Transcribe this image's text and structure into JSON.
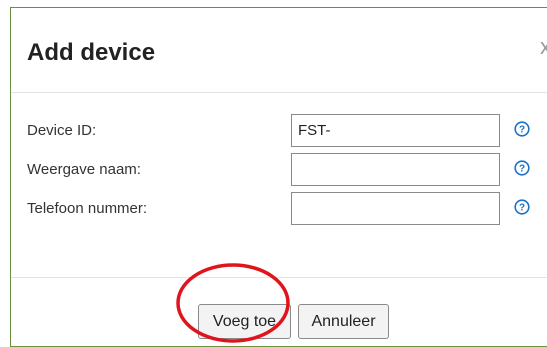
{
  "dialog": {
    "title": "Add device",
    "close_label": "x"
  },
  "form": {
    "fields": [
      {
        "label": "Device ID:",
        "value": "FST-",
        "placeholder": ""
      },
      {
        "label": "Weergave naam:",
        "value": "",
        "placeholder": ""
      },
      {
        "label": "Telefoon nummer:",
        "value": "",
        "placeholder": ""
      }
    ]
  },
  "footer": {
    "add_label": "Voeg toe",
    "cancel_label": "Annuleer"
  },
  "colors": {
    "dialog_border": "#6a8f3d",
    "help_icon": "#1a73c8",
    "annotation_ellipse": "#e0141c"
  },
  "icons": {
    "help": "help-icon",
    "close": "close-icon"
  }
}
